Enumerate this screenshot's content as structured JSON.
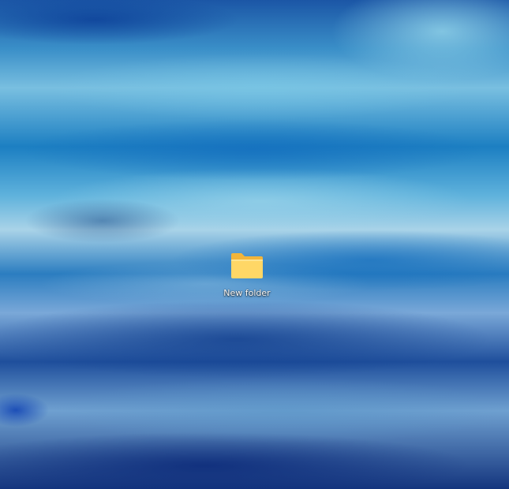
{
  "desktop": {
    "icons": [
      {
        "label": "New folder",
        "icon": "folder-icon",
        "colors": {
          "folder_front": "#FFD766",
          "folder_back": "#F2B53A"
        }
      }
    ]
  }
}
